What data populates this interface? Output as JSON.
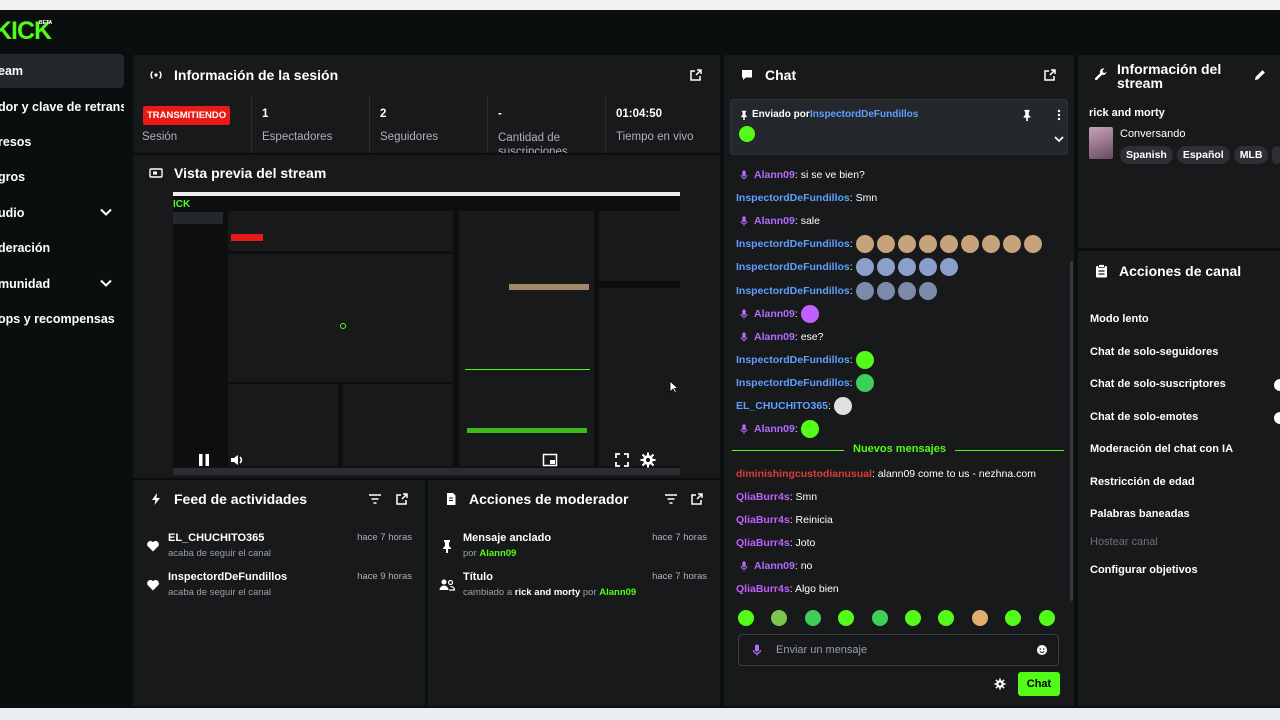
{
  "app": {
    "logo": "KICK",
    "logo_badge": "BETA"
  },
  "sidebar": {
    "items": [
      {
        "label": "eam"
      },
      {
        "label": "dor y clave de retransn"
      },
      {
        "label": "resos"
      },
      {
        "label": "gros"
      },
      {
        "label": "udio"
      },
      {
        "label": "deración"
      },
      {
        "label": "munidad"
      },
      {
        "label": "ops y recompensas"
      }
    ]
  },
  "session": {
    "title": "Información de la sesión",
    "status": "TRANSMITIENDO",
    "status_label": "Sesión",
    "stats": [
      {
        "value": "1",
        "label": "Espectadores"
      },
      {
        "value": "2",
        "label": "Seguidores"
      },
      {
        "value": "-",
        "label": "Cantidad de suscripciones"
      },
      {
        "value": "01:04:50",
        "label": "Tiempo en vivo"
      }
    ]
  },
  "preview": {
    "title": "Vista previa del stream"
  },
  "feed": {
    "title": "Feed de actividades",
    "items": [
      {
        "user": "EL_CHUCHITO365",
        "desc": "acaba de seguir el canal",
        "time": "hace 7 horas"
      },
      {
        "user": "InspectordDeFundillos",
        "desc": "acaba de seguir el canal",
        "time": "hace 9 horas"
      }
    ]
  },
  "mod": {
    "title": "Acciones de moderador",
    "items": [
      {
        "action": "Mensaje anclado",
        "by": "por",
        "user": "Alann09",
        "time": "hace 7 horas"
      },
      {
        "action": "Título",
        "pre": "cambiado a",
        "value": "rick and morty",
        "by": "por",
        "user": "Alann09",
        "time": "hace 7 horas"
      }
    ]
  },
  "chat": {
    "title": "Chat",
    "pinned_prefix": "Enviado por",
    "pinned_user": "InspectordDeFundillos",
    "new_messages": "Nuevos mensajes",
    "input_placeholder": "Enviar un mensaje",
    "send_label": "Chat",
    "messages": [
      {
        "user": "Alann09",
        "text": ": si se ve bien?",
        "mic": true,
        "color": "#b36cff",
        "emotes": 0
      },
      {
        "user": "InspectordDeFundillos",
        "text": ": Smn",
        "mic": false,
        "color": "#5ea0ff",
        "emotes": 0
      },
      {
        "user": "Alann09",
        "text": ": sale",
        "mic": true,
        "color": "#b36cff",
        "emotes": 0
      },
      {
        "user": "InspectordDeFundillos",
        "text": ":",
        "mic": false,
        "color": "#5ea0ff",
        "emotes": 9,
        "emote_color": "#c7a27a"
      },
      {
        "user": "InspectordDeFundillos",
        "text": ":",
        "mic": false,
        "color": "#5ea0ff",
        "emotes": 5,
        "emote_color": "#8aa0c8"
      },
      {
        "user": "InspectordDeFundillos",
        "text": ":",
        "mic": false,
        "color": "#5ea0ff",
        "emotes": 4,
        "emote_color": "#7a8aa8"
      },
      {
        "user": "Alann09",
        "text": ":",
        "mic": true,
        "color": "#b36cff",
        "emotes": 1,
        "emote_color": "#c060ff"
      },
      {
        "user": "Alann09",
        "text": ": ese?",
        "mic": true,
        "color": "#b36cff",
        "emotes": 0
      },
      {
        "user": "InspectordDeFundillos",
        "text": ":",
        "mic": false,
        "color": "#5ea0ff",
        "emotes": 1,
        "emote_color": "#53fc18"
      },
      {
        "user": "InspectordDeFundillos",
        "text": ":",
        "mic": false,
        "color": "#5ea0ff",
        "emotes": 1,
        "emote_color": "#3ecf58"
      },
      {
        "user": "EL_CHUCHITO365",
        "text": ":",
        "mic": false,
        "color": "#5ea0ff",
        "emotes": 1,
        "emote_color": "#e0e0e0"
      },
      {
        "user": "Alann09",
        "text": ":",
        "mic": true,
        "color": "#b36cff",
        "emotes": 1,
        "emote_color": "#53fc18"
      }
    ],
    "new_list": [
      {
        "user": "diminishingcustodianusual",
        "text": ": alann09 come to us - nezhna.com",
        "mic": false,
        "color": "#e03a3a"
      },
      {
        "user": "QliaBurr4s",
        "text": ": Smn",
        "mic": false,
        "color": "#c060ff"
      },
      {
        "user": "QliaBurr4s",
        "text": ": Reinicia",
        "mic": false,
        "color": "#c060ff"
      },
      {
        "user": "QliaBurr4s",
        "text": ": Joto",
        "mic": false,
        "color": "#c060ff"
      },
      {
        "user": "Alann09",
        "text": ": no",
        "mic": true,
        "color": "#b36cff"
      },
      {
        "user": "QliaBurr4s",
        "text": ": Algo bien",
        "mic": false,
        "color": "#c060ff"
      }
    ]
  },
  "stream_info": {
    "title": "Información del stream",
    "stream_title": "rick and morty",
    "category": "Conversando",
    "tags": [
      "Spanish",
      "Español",
      "MLB"
    ]
  },
  "channel_actions": {
    "title": "Acciones de canal",
    "items": [
      {
        "label": "Modo lento",
        "disabled": false,
        "toggle": false
      },
      {
        "label": "Chat de solo-seguidores",
        "disabled": false,
        "toggle": false
      },
      {
        "label": "Chat de solo-suscriptores",
        "disabled": false,
        "toggle": true
      },
      {
        "label": "Chat de solo-emotes",
        "disabled": false,
        "toggle": true
      },
      {
        "label": "Moderación del chat con IA",
        "disabled": false,
        "toggle": false
      },
      {
        "label": "Restricción de edad",
        "disabled": false,
        "toggle": false
      },
      {
        "label": "Palabras baneadas",
        "disabled": false,
        "toggle": false
      },
      {
        "label": "Hostear canal",
        "disabled": true,
        "toggle": false
      },
      {
        "label": "Configurar objetivos",
        "disabled": false,
        "toggle": false
      }
    ]
  },
  "colors": {
    "accent": "#53fc18",
    "panel": "#18191b",
    "live": "#e91916"
  }
}
